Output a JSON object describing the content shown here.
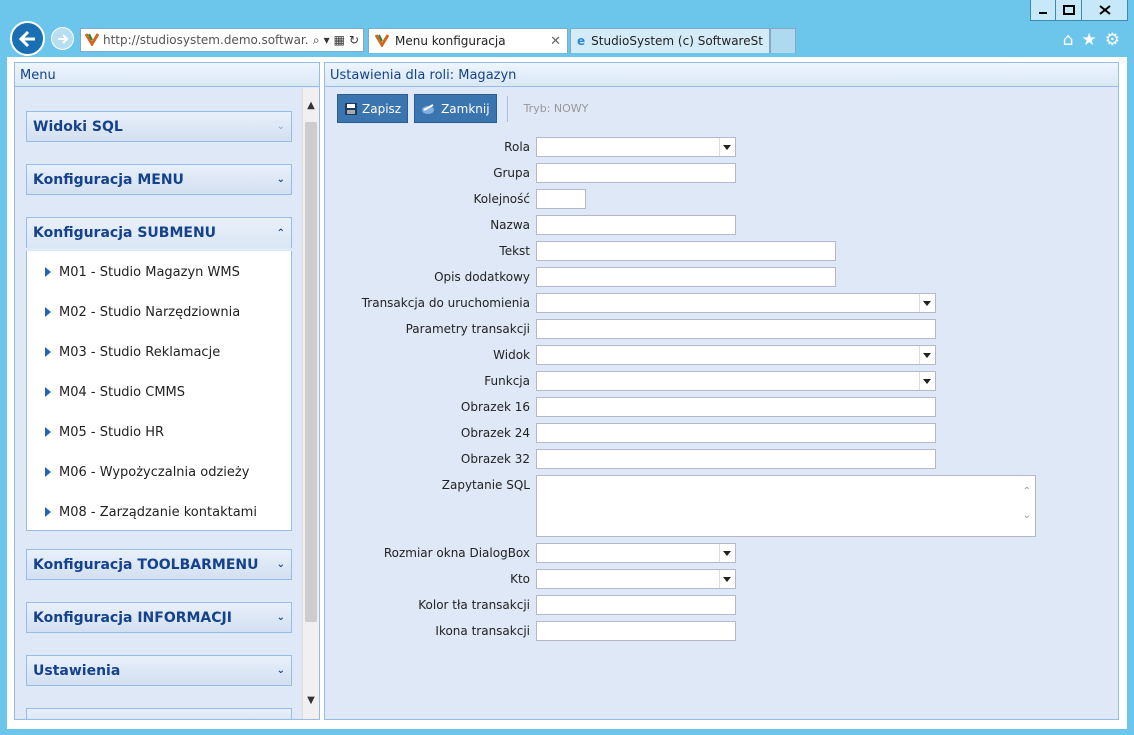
{
  "browser": {
    "address_url": "http://studiosystem.demo.softwar...",
    "tabs": [
      {
        "label": "Menu konfiguracja",
        "active": true
      },
      {
        "label": "StudioSystem (c) SoftwareStud...",
        "active": false
      }
    ],
    "window_buttons": [
      "minimize-icon",
      "maximize-icon",
      "close-icon"
    ]
  },
  "menu": {
    "title": "Menu",
    "sections": [
      {
        "label": "Widoki SQL",
        "expanded": false
      },
      {
        "label": "Konfiguracja MENU",
        "expanded": false
      },
      {
        "label": "Konfiguracja SUBMENU",
        "expanded": true
      },
      {
        "label": "Konfiguracja TOOLBARMENU",
        "expanded": false
      },
      {
        "label": "Konfiguracja INFORMACJI",
        "expanded": false
      },
      {
        "label": "Ustawienia",
        "expanded": false
      }
    ],
    "submenu_items": [
      "M01 - Studio Magazyn WMS",
      "M02 - Studio Narzędziownia",
      "M03 - Studio Reklamacje",
      "M04 - Studio CMMS",
      "M05 - Studio HR",
      "M06 - Wypożyczalnia odzieży",
      "M08 - Zarządzanie kontaktami"
    ]
  },
  "form": {
    "title": "Ustawienia dla roli: Magazyn",
    "toolbar": {
      "save_label": "Zapisz",
      "close_label": "Zamknij",
      "mode_label": "Tryb: NOWY"
    },
    "fields": [
      {
        "label": "Rola",
        "type": "combo",
        "value": ""
      },
      {
        "label": "Grupa",
        "type": "text",
        "value": ""
      },
      {
        "label": "Kolejność",
        "type": "text",
        "value": ""
      },
      {
        "label": "Nazwa",
        "type": "text",
        "value": ""
      },
      {
        "label": "Tekst",
        "type": "text",
        "value": ""
      },
      {
        "label": "Opis dodatkowy",
        "type": "text",
        "value": ""
      },
      {
        "label": "Transakcja do uruchomienia",
        "type": "combo",
        "value": ""
      },
      {
        "label": "Parametry transakcji",
        "type": "text",
        "value": ""
      },
      {
        "label": "Widok",
        "type": "combo",
        "value": ""
      },
      {
        "label": "Funkcja",
        "type": "combo",
        "value": ""
      },
      {
        "label": "Obrazek 16",
        "type": "text",
        "value": ""
      },
      {
        "label": "Obrazek 24",
        "type": "text",
        "value": ""
      },
      {
        "label": "Obrazek 32",
        "type": "text",
        "value": ""
      },
      {
        "label": "Zapytanie SQL",
        "type": "textarea",
        "value": ""
      },
      {
        "label": "Rozmiar okna DialogBox",
        "type": "combo",
        "value": ""
      },
      {
        "label": "Kto",
        "type": "combo",
        "value": ""
      },
      {
        "label": "Kolor tła transakcji",
        "type": "text",
        "value": ""
      },
      {
        "label": "Ikona transakcji",
        "type": "text",
        "value": ""
      }
    ]
  }
}
